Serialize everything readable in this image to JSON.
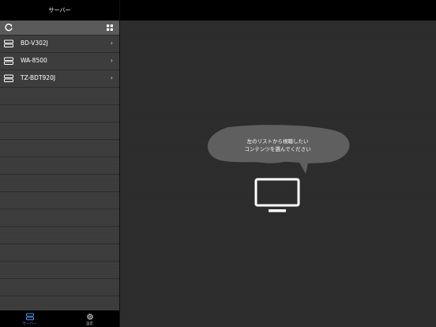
{
  "sidebar": {
    "title": "サーバー",
    "toolbar": {
      "refresh_icon": "refresh-icon",
      "grid_icon": "grid-view-icon"
    },
    "servers": [
      {
        "name": "BD-V302J",
        "icon": "server-icon"
      },
      {
        "name": "WA-8500",
        "icon": "server-icon"
      },
      {
        "name": "TZ-BDT920J",
        "icon": "server-icon"
      }
    ],
    "chevron": "›"
  },
  "tabbar": {
    "tabs": [
      {
        "label": "サーバー",
        "icon": "server-icon",
        "selected": true
      },
      {
        "label": "設定",
        "icon": "gear-icon",
        "selected": false
      }
    ]
  },
  "main": {
    "message_line1": "左のリストから視聴したい",
    "message_line2": "コンテンツを選んでください",
    "tv_icon": "tv-icon"
  },
  "colors": {
    "accent": "#4a90e2",
    "background": "#2b2b2b",
    "sidebar": "#3b3b3b"
  }
}
